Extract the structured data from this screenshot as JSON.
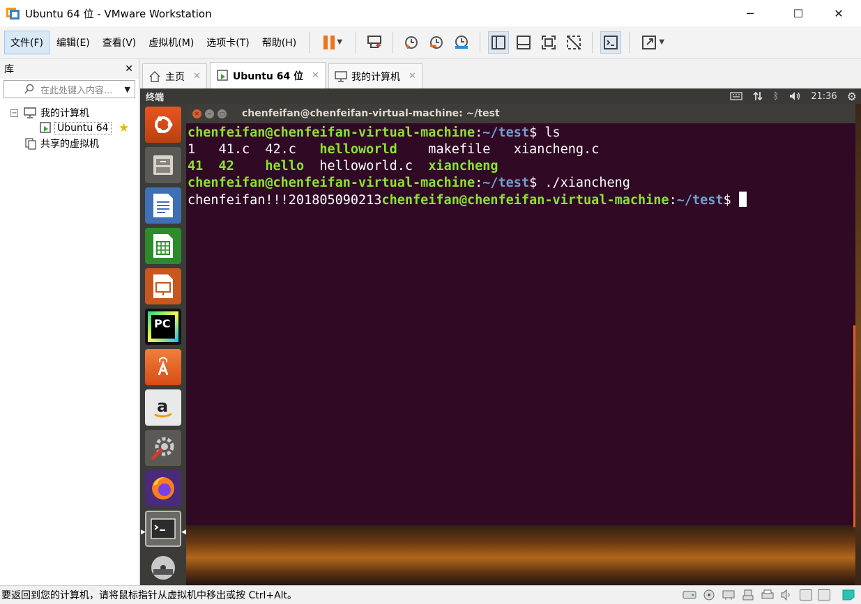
{
  "window": {
    "title": "Ubuntu 64 位 - VMware Workstation",
    "minimize": "─",
    "maximize": "☐",
    "close": "✕"
  },
  "menu": {
    "items": [
      "文件(F)",
      "编辑(E)",
      "查看(V)",
      "虚拟机(M)",
      "选项卡(T)",
      "帮助(H)"
    ]
  },
  "toolbar": {
    "icons": [
      "pause-icon",
      "send-ctrl-alt-del-icon",
      "snapshot-icon",
      "revert-snapshot-icon",
      "snapshot-manager-icon",
      "library-view-icon",
      "thumbnail-view-icon",
      "fullscreen-icon",
      "unity-icon",
      "console-icon",
      "stretch-icon"
    ]
  },
  "library": {
    "title": "库",
    "close": "✕",
    "search_placeholder": "在此处键入内容...",
    "tree": {
      "root": "我的计算机",
      "vm": "Ubuntu 64",
      "shared": "共享的虚拟机",
      "collapse": "−"
    }
  },
  "tabs": [
    {
      "label": "主页",
      "close": "✕"
    },
    {
      "label": "Ubuntu 64 位",
      "close": "✕"
    },
    {
      "label": "我的计算机",
      "close": "✕"
    }
  ],
  "guest": {
    "app_title": "终端",
    "time": "21:36",
    "terminal_title": "chenfeifan@chenfeifan-virtual-machine: ~/test",
    "launcher_badge": "PC",
    "lines": {
      "l1_prompt": "chenfeifan@chenfeifan-virtual-machine",
      "l1_colon": ":",
      "l1_path": "~/test",
      "l1_cmd": "$ ls",
      "l2_a": "1   41.c  42.c   ",
      "l2_b": "helloworld",
      "l2_c": "    makefile   xiancheng.c",
      "l3_a": "41  42",
      "l3_sp1": "    ",
      "l3_b": "hello",
      "l3_c": "  helloworld.c  ",
      "l3_d": "xiancheng",
      "l4_prompt": "chenfeifan@chenfeifan-virtual-machine",
      "l4_colon": ":",
      "l4_path": "~/test",
      "l4_cmd": "$ ./xiancheng",
      "l5_out": "chenfeifan!!!201805090213",
      "l5_prompt": "chenfeifan@chenfeifan-virtual-machine",
      "l5_colon": ":",
      "l5_path": "~/test",
      "l5_cmd": "$ "
    }
  },
  "status": {
    "text": "要返回到您的计算机，请将鼠标指针从虚拟机中移出或按 Ctrl+Alt。"
  },
  "colors": {
    "terminal_bg": "#300a24",
    "prompt_green": "#8ae234",
    "path_blue": "#729fcf",
    "launcher_bg": "#3c3b37",
    "pause_orange": "#f0731c"
  }
}
